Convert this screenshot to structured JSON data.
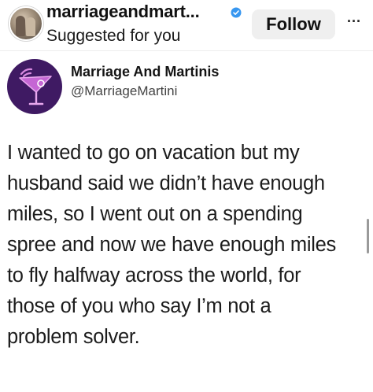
{
  "post_header": {
    "username": "marriageandmart...",
    "subtitle": "Suggested for you",
    "follow_label": "Follow",
    "more_label": "...",
    "verified_color": "#3897f0"
  },
  "tweet": {
    "display_name": "Marriage And Martinis",
    "handle": "@MarriageMartini",
    "avatar_bg": "#3f1a63",
    "avatar_icon": "martini-glass-icon",
    "lines": [
      "I wanted to go on vacation but my",
      "husband said we didn’t have enough",
      "miles, so I went out on a spending",
      "spree and now we have enough miles",
      "to fly halfway across the world, for",
      "those of you who say I’m not a",
      "problem solver."
    ]
  }
}
